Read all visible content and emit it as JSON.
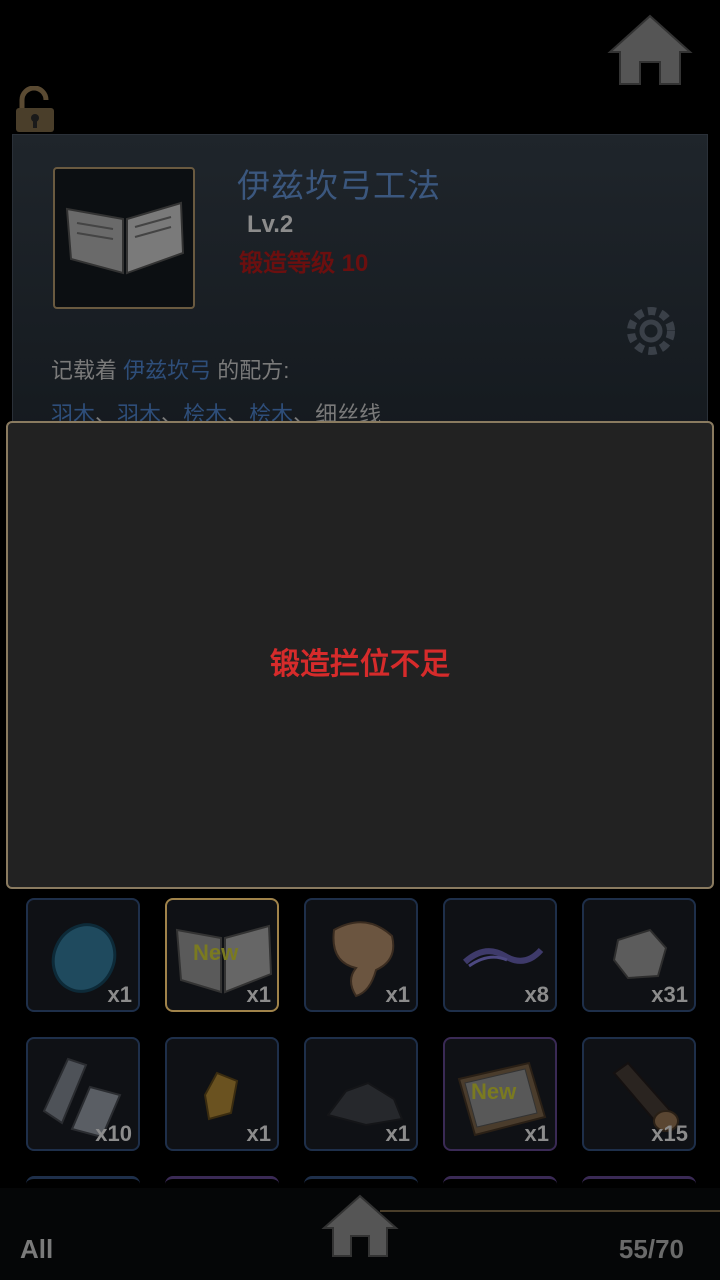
{
  "header": {
    "home_icon": "home-icon",
    "lock_icon": "unlock-icon"
  },
  "item_detail": {
    "name": "伊兹坎弓工法",
    "level": "Lv.2",
    "forge_level": "锻造等级 10",
    "description_prefix": "记载着",
    "description_item": "伊兹坎弓",
    "description_suffix": "的配方:",
    "materials": [
      "羽木",
      "羽木",
      "桧木",
      "桧木",
      "细丝线"
    ],
    "separator": "、"
  },
  "dialog": {
    "message": "锻造拦位不足"
  },
  "inventory": {
    "slots": [
      {
        "icon": "blue-egg-icon",
        "qty": "x1",
        "new": ""
      },
      {
        "icon": "open-book-icon",
        "qty": "x1",
        "new": "New"
      },
      {
        "icon": "leather-hide-icon",
        "qty": "x1",
        "new": ""
      },
      {
        "icon": "string-icon",
        "qty": "x8",
        "new": ""
      },
      {
        "icon": "stone-chunk-icon",
        "qty": "x31",
        "new": ""
      },
      {
        "icon": "metal-ingot-icon",
        "qty": "x10",
        "new": ""
      },
      {
        "icon": "gold-crystal-icon",
        "qty": "x1",
        "new": ""
      },
      {
        "icon": "coal-ore-icon",
        "qty": "x1",
        "new": ""
      },
      {
        "icon": "recipe-book-icon",
        "qty": "x1",
        "new": "New"
      },
      {
        "icon": "wood-log-icon",
        "qty": "x15",
        "new": ""
      }
    ]
  },
  "footer": {
    "tab_label": "All",
    "capacity": "55/70"
  }
}
